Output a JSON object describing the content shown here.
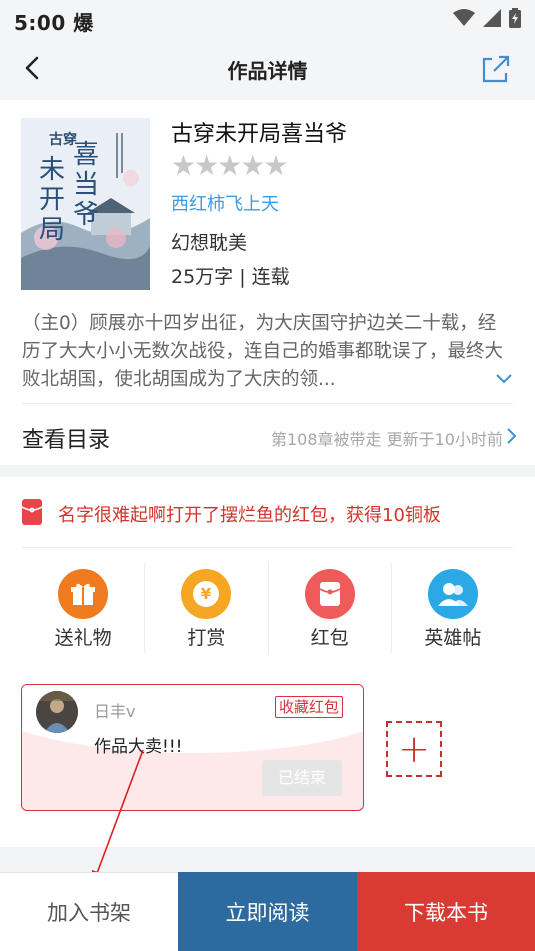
{
  "status_bar": {
    "time": "5:00",
    "carrier_glyph": "爆",
    "icons": [
      "wifi-icon",
      "signal-icon",
      "battery-icon"
    ]
  },
  "nav": {
    "title": "作品详情",
    "back_icon": "back-arrow-icon",
    "share_icon": "share-icon"
  },
  "book": {
    "title": "古穿未开局喜当爷",
    "rating_stars": 0,
    "rating_max": 5,
    "stars_text": "★★★★★",
    "author": "西红柿飞上天",
    "genre": "幻想耽美",
    "stats": "25万字 | 连载",
    "synopsis": "（主0）顾展亦十四岁出征，为大庆国守护边关二十载，经历了大大小小无数次战役，连自己的婚事都耽误了，最终大败北胡国，使北胡国成为了大庆的领...",
    "cover_lettering": "古穿 未开局 喜当爷"
  },
  "toc": {
    "label": "查看目录",
    "update": "第108章被带走  更新于10小时前"
  },
  "notice": {
    "text": "名字很难起啊打开了摆烂鱼的红包，获得10铜板"
  },
  "actions": [
    {
      "label": "送礼物",
      "icon": "gift-icon",
      "color": "#f07a1e"
    },
    {
      "label": "打赏",
      "icon": "yen-coin-icon",
      "color": "#f5a623"
    },
    {
      "label": "红包",
      "icon": "red-envelope-icon",
      "color": "#ef5b5b"
    },
    {
      "label": "英雄帖",
      "icon": "heroes-icon",
      "color": "#2aa9e6"
    }
  ],
  "post": {
    "user": "日丰v",
    "badge": "收藏红包",
    "content": "作品大卖!!!",
    "status": "已结束"
  },
  "add_post": {
    "symbol": "+"
  },
  "bottom_bar": {
    "shelf": "加入书架",
    "read": "立即阅读",
    "download": "下载本书"
  },
  "colors": {
    "accent_blue": "#2c6aa0",
    "accent_red": "#d93a31",
    "author_blue": "#3f9be3"
  }
}
